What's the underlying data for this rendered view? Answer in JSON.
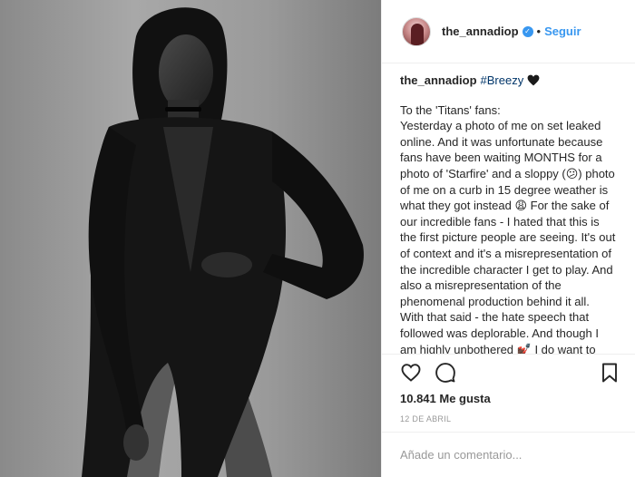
{
  "photo": {
    "alt_icon": "photo-of-person"
  },
  "header": {
    "username": "the_annadiop",
    "verified_icon": "check-icon",
    "separator": "•",
    "follow_label": "Seguir"
  },
  "caption": {
    "username": "the_annadiop",
    "hashtag": "#Breezy",
    "heart_icon": "black-heart-emoji",
    "body": "To the 'Titans' fans:\nYesterday a photo of me on set leaked online. And it was unfortunate because fans have been waiting MONTHS for a photo of 'Starfire' and a sloppy (😕) photo of me on a curb in 15 degree weather is what they got instead 😩 For the sake of our incredible fans - I hated that this is the first picture people are seeing. It's out of context and it's a misrepresentation of the incredible character I get to play. And also a misrepresentation of the phenomenal production behind it all.\nWith that said - the hate speech that followed was deplorable. And though I am highly unbothered 💅🏿 I do want to use this as an opportunity to say that tearing people down is not something that I"
  },
  "actions": {
    "like_icon": "heart-icon",
    "comment_icon": "comment-icon",
    "save_icon": "bookmark-icon"
  },
  "likes": "10.841 Me gusta",
  "date": "12 DE ABRIL",
  "comment": {
    "placeholder": "Añade un comentario..."
  },
  "colors": {
    "link_blue": "#3897f0",
    "hashtag": "#003569",
    "text": "#262626",
    "muted": "#999999",
    "border": "#efefef"
  }
}
